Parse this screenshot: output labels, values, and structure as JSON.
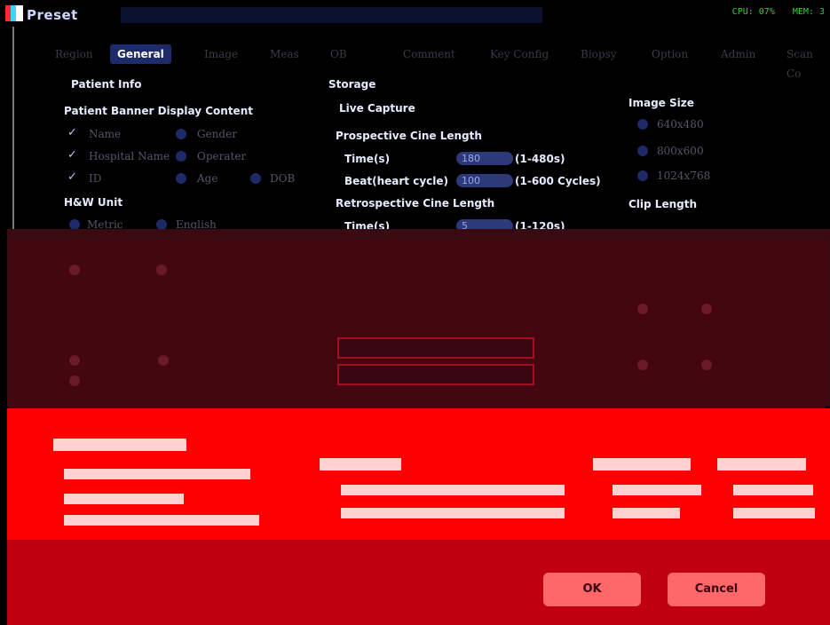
{
  "window": {
    "title": "Preset"
  },
  "system": {
    "cpu": "CPU: 07%",
    "mem": "MEM: 3"
  },
  "tabs": [
    "Region",
    "General",
    "Image",
    "Meas",
    "OB",
    "Comment",
    "Key Config",
    "Biopsy",
    "Option",
    "Admin",
    "Scan Co"
  ],
  "active_tab": "General",
  "patient": {
    "heading": "Patient Info",
    "banner_heading": "Patient Banner Display Content",
    "options": [
      {
        "label": "Name",
        "checked": true
      },
      {
        "label": "Gender",
        "checked": false
      },
      {
        "label": "Hospital Name",
        "checked": true
      },
      {
        "label": "Operater",
        "checked": false
      },
      {
        "label": "ID",
        "checked": true
      },
      {
        "label": "Age",
        "checked": false
      },
      {
        "label": "DOB",
        "checked": false
      }
    ],
    "hw_heading": "H&W Unit",
    "hw_options": [
      "Metric",
      "English"
    ]
  },
  "storage": {
    "heading": "Storage",
    "live_capture": "Live Capture",
    "prospective": "Prospective Cine Length",
    "time_label": "Time(s)",
    "time_value": "180",
    "time_range": "(1-480s)",
    "beat_label": "Beat(heart cycle)",
    "beat_value": "100",
    "beat_range": "(1-600 Cycles)",
    "retrospective": "Retrospective Cine Length",
    "retro_time_label": "Time(s)",
    "retro_time_value": "5",
    "retro_time_range": "(1-120s)"
  },
  "image_size": {
    "heading": "Image Size",
    "options": [
      "640x480",
      "800x600",
      "1024x768"
    ]
  },
  "clip_length": {
    "heading": "Clip Length"
  },
  "buttons": {
    "ok": "OK",
    "cancel": "Cancel"
  }
}
